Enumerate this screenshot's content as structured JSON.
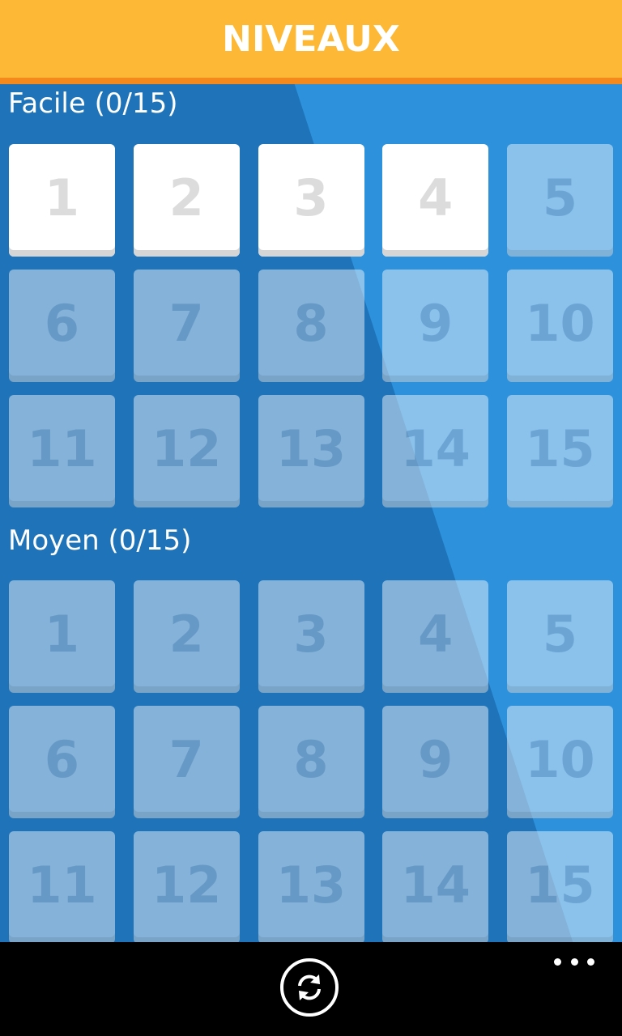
{
  "header": {
    "title": "NIVEAUX"
  },
  "sections": [
    {
      "id": "facile",
      "title": "Facile (0/15)",
      "levels": [
        {
          "number": "1",
          "unlocked": true
        },
        {
          "number": "2",
          "unlocked": true
        },
        {
          "number": "3",
          "unlocked": true
        },
        {
          "number": "4",
          "unlocked": true
        },
        {
          "number": "5",
          "unlocked": false
        },
        {
          "number": "6",
          "unlocked": false
        },
        {
          "number": "7",
          "unlocked": false
        },
        {
          "number": "8",
          "unlocked": false
        },
        {
          "number": "9",
          "unlocked": false
        },
        {
          "number": "10",
          "unlocked": false
        },
        {
          "number": "11",
          "unlocked": false
        },
        {
          "number": "12",
          "unlocked": false
        },
        {
          "number": "13",
          "unlocked": false
        },
        {
          "number": "14",
          "unlocked": false
        },
        {
          "number": "15",
          "unlocked": false
        }
      ]
    },
    {
      "id": "moyen",
      "title": "Moyen (0/15)",
      "levels": [
        {
          "number": "1",
          "unlocked": false
        },
        {
          "number": "2",
          "unlocked": false
        },
        {
          "number": "3",
          "unlocked": false
        },
        {
          "number": "4",
          "unlocked": false
        },
        {
          "number": "5",
          "unlocked": false
        },
        {
          "number": "6",
          "unlocked": false
        },
        {
          "number": "7",
          "unlocked": false
        },
        {
          "number": "8",
          "unlocked": false
        },
        {
          "number": "9",
          "unlocked": false
        },
        {
          "number": "10",
          "unlocked": false
        },
        {
          "number": "11",
          "unlocked": false
        },
        {
          "number": "12",
          "unlocked": false
        },
        {
          "number": "13",
          "unlocked": false
        },
        {
          "number": "14",
          "unlocked": false
        },
        {
          "number": "15",
          "unlocked": false
        }
      ]
    }
  ],
  "app_bar": {
    "primary_icon": "refresh-icon",
    "overflow_icon": "more-icon"
  },
  "colors": {
    "header_bg": "#fdb935",
    "header_border": "#f5891b",
    "background_light": "#2f97e2",
    "background_dark": "#1f73b8",
    "tile_unlocked": "#ffffff",
    "app_bar_bg": "#000000"
  }
}
